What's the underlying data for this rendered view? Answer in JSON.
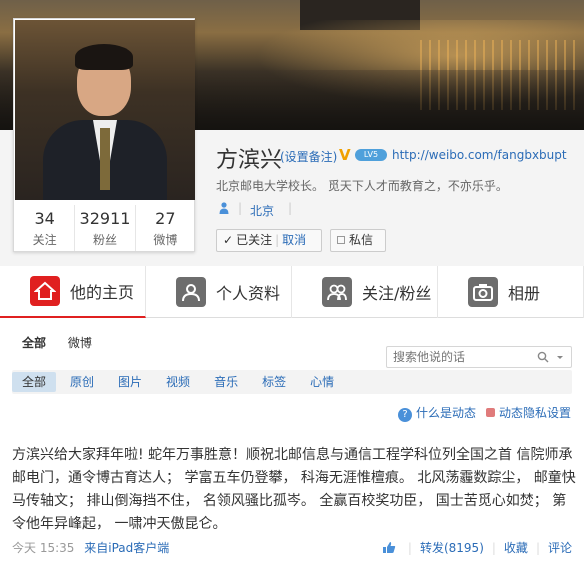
{
  "profile": {
    "name": "方滨兴",
    "remark": "(设置备注)",
    "level": "LV5",
    "url": "http://weibo.com/fangbxbupt",
    "bio": "北京邮电大学校长。  觅天下人才而教育之，不亦乐乎。",
    "location": "北京",
    "follow_label": "已关注",
    "unfollow_label": "取消",
    "message_label": "私信"
  },
  "stats": [
    {
      "value": "34",
      "label": "关注"
    },
    {
      "value": "32911",
      "label": "粉丝"
    },
    {
      "value": "27",
      "label": "微博"
    }
  ],
  "tabs": [
    {
      "label": "他的主页",
      "icon": "home-icon"
    },
    {
      "label": "个人资料",
      "icon": "profile-icon"
    },
    {
      "label": "关注/粉丝",
      "icon": "users-icon"
    },
    {
      "label": "相册",
      "icon": "camera-icon"
    }
  ],
  "filter_main": [
    "全部",
    "微博"
  ],
  "search": {
    "placeholder": "搜索他说的话"
  },
  "filter_sub": [
    "全部",
    "原创",
    "图片",
    "视频",
    "音乐",
    "标签",
    "心情"
  ],
  "help_label": "什么是动态",
  "privacy_label": "动态隐私设置",
  "post": {
    "text": "方滨兴给大家拜年啦! 蛇年万事胜意！顺祝北邮信息与通信工程学科位列全国之首 信院师承邮电门，通令博古育达人； 学富五车仍登攀， 科海无涯惟檀痕。 北风荡霾数踪尘， 邮童快马传轴文； 排山倒海挡不住， 名领风骚比孤岑。 全赢百校奖功臣， 国士苦觅心如焚； 第令他年异峰起， 一啸冲天傲昆仑。",
    "time": "今天 15:35",
    "source": "来自iPad客户端",
    "repost": "转发(8195)",
    "favorite": "收藏",
    "comment": "评论"
  },
  "colors": {
    "accent": "#e02020",
    "link": "#2b6cb7"
  }
}
